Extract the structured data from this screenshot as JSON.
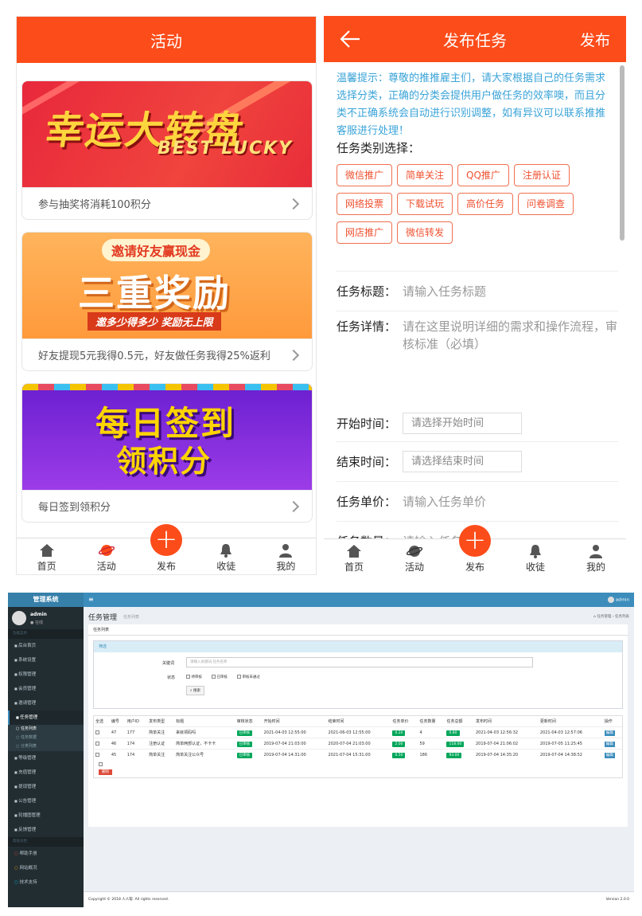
{
  "phone1": {
    "title": "活动",
    "cards": [
      {
        "banner_main": "幸运大转盘",
        "banner_sub": "BEST LUCKY",
        "caption": "参与抽奖将消耗100积分"
      },
      {
        "banner_top": "邀请好友赢现金",
        "banner_main": "三重奖励",
        "banner_sub": "邀多少得多少  奖励无上限",
        "caption": "好友提现5元我得0.5元，好友做任务我得25%返利"
      },
      {
        "banner_main": "每日签到",
        "banner_sub": "领积分",
        "caption": "每日签到领积分"
      }
    ],
    "tabs": [
      "首页",
      "活动",
      "发布",
      "收徒",
      "我的"
    ]
  },
  "phone2": {
    "title": "发布任务",
    "publish": "发布",
    "tip": "温馨提示：尊敬的推推雇主们，请大家根据自己的任务需求选择分类，正确的分类会提供用户做任务的效率噢，而且分类不正确系统会自动进行识别调整，如有异议可以联系推推客服进行处理！",
    "category_label": "任务类别选择：",
    "categories": [
      "微信推广",
      "简单关注",
      "QQ推广",
      "注册认证",
      "网络投票",
      "下载试玩",
      "高价任务",
      "问卷调查",
      "网店推广",
      "微信转发"
    ],
    "fields": {
      "title_label": "任务标题：",
      "title_ph": "请输入任务标题",
      "detail_label": "任务详情：",
      "detail_ph": "请在这里说明详细的需求和操作流程，审核标准（必填）",
      "start_label": "开始时间：",
      "start_ph": "请选择开始时间",
      "end_label": "结束时间：",
      "end_ph": "请选择结束时间",
      "price_label": "任务单价：",
      "price_ph": "请输入任务单价",
      "qty_label": "任务数量：",
      "qty_ph": "请输入任务数量"
    },
    "tabs": [
      "首页",
      "活动",
      "发布",
      "收徒",
      "我的"
    ]
  },
  "admin": {
    "brand": "管理系统",
    "user": "admin",
    "online": "在线",
    "nav_header": "功能菜单",
    "menu": [
      "后台首页",
      "系统设置",
      "权限管理",
      "会员管理",
      "邀请管理",
      "任务管理",
      "等级管理",
      "充值管理",
      "提现管理",
      "公告管理",
      "轮播图管理",
      "反馈管理"
    ],
    "submenu": [
      "任务列表",
      "任务数据",
      "分类列表"
    ],
    "help_header": "帮助文档",
    "help": [
      "帮助手册",
      "网站概况",
      "技术支持"
    ],
    "page_title": "任务管理",
    "page_sub": "任务列表",
    "crumb": [
      "任务管理",
      "任务列表"
    ],
    "tab": "任务列表",
    "filter": "筛选",
    "kw_label": "关键词",
    "kw_ph": "请输入关键词,任务名称",
    "status_label": "状态",
    "status_opts": [
      "待审核",
      "已审核",
      "审核未通过"
    ],
    "search": "搜索",
    "columns": [
      "全选",
      "编号",
      "用户ID",
      "发布类型",
      "标题",
      "审核状态",
      "开始时间",
      "结束时间",
      "任务单价",
      "任务数量",
      "任务总额",
      "发布时间",
      "更新时间",
      "操作"
    ],
    "rows": [
      [
        "47",
        "177",
        "简单关注",
        "来就领码吗",
        "已审核",
        "2021-04-03 12:55:00",
        "2021-06-03 12:55:00",
        "0.20",
        "4",
        "0.80",
        "2021-04-03 12:56:32",
        "2021-04-03 12:57:06",
        "编辑"
      ],
      [
        "46",
        "174",
        "注册认证",
        "简单两部认证，不卡卡",
        "已审核",
        "2019-07-04 21:03:00",
        "2020-07-04 21:03:00",
        "2.00",
        "59",
        "118.00",
        "2019-07-04 21:06:02",
        "2019-07-05 11:25:45",
        "编辑"
      ],
      [
        "45",
        "174",
        "简单关注",
        "简单关注公众号",
        "已审核",
        "2019-07-04 14:31:00",
        "2021-07-04 15:31:00",
        "0.50",
        "186",
        "93.00",
        "2019-07-04 14:35:20",
        "2019-07-04 14:38:52",
        "编辑"
      ]
    ],
    "delete": "删除",
    "footer_left": "Copyright © 2018 人人帮. All rights reserved.",
    "footer_right": "Version 2.0.0",
    "colors": {
      "nav": "#3c8dbc",
      "side": "#222d32",
      "green": "#00a65a",
      "orange": "#fc4c1a"
    }
  }
}
